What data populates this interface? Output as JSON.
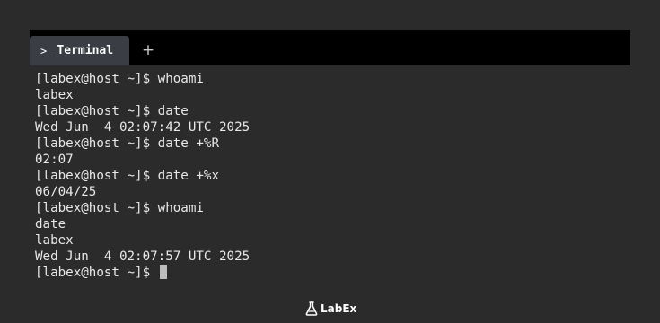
{
  "tab": {
    "icon": "terminal-prompt-icon",
    "prompt_glyph": ">_",
    "label": "Terminal"
  },
  "new_tab": {
    "icon": "plus-icon",
    "glyph": "+"
  },
  "terminal": {
    "lines": [
      "[labex@host ~]$ whoami",
      "labex",
      "[labex@host ~]$ date",
      "Wed Jun  4 02:07:42 UTC 2025",
      "[labex@host ~]$ date +%R",
      "02:07",
      "[labex@host ~]$ date +%x",
      "06/04/25",
      "[labex@host ~]$ whoami",
      "date",
      "labex",
      "Wed Jun  4 02:07:57 UTC 2025"
    ],
    "current_prompt": "[labex@host ~]$ "
  },
  "brand": {
    "logo_text": "LabEx",
    "icon": "flask-icon"
  }
}
